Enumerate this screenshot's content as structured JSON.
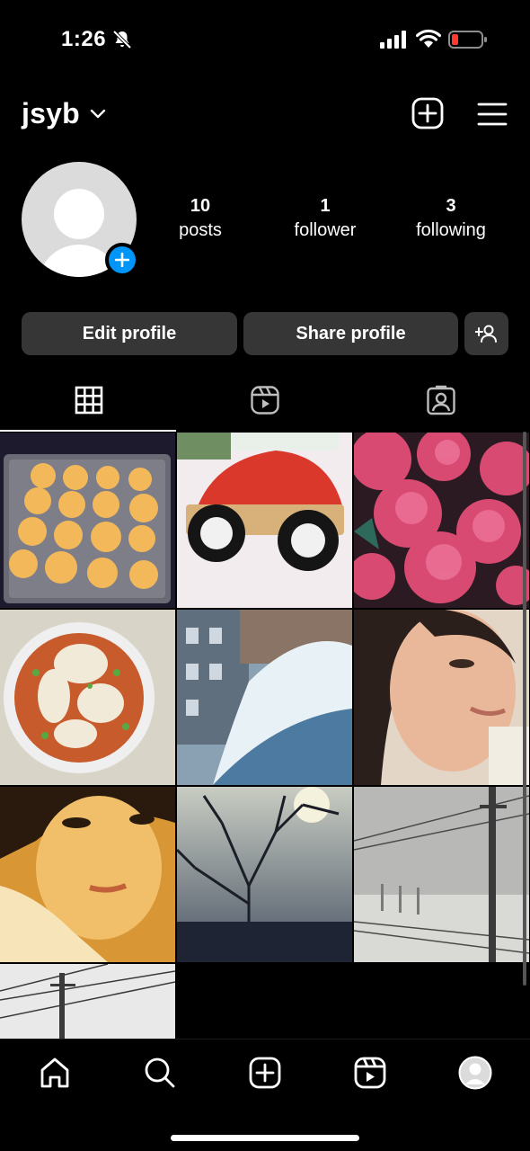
{
  "status_bar": {
    "time": "1:26",
    "icons": [
      "bell-slash-icon",
      "cellular-signal-icon",
      "wifi-icon",
      "battery-icon"
    ],
    "battery_color": "#ff3b30"
  },
  "header": {
    "username": "jsyb",
    "icons": [
      "chevron-down-icon",
      "plus-square-icon",
      "hamburger-menu-icon"
    ]
  },
  "profile": {
    "stats": {
      "posts": {
        "count": "10",
        "label": "posts"
      },
      "followers": {
        "count": "1",
        "label": "follower"
      },
      "following": {
        "count": "3",
        "label": "following"
      }
    },
    "buttons": {
      "edit": "Edit profile",
      "share": "Share profile"
    }
  },
  "tabs": [
    "grid-icon",
    "reels-icon",
    "tagged-icon"
  ],
  "grid": {
    "posts": [
      {
        "subject": "tray-of-baked-puffs"
      },
      {
        "subject": "red-wooden-toy-car"
      },
      {
        "subject": "pink-carnations"
      },
      {
        "subject": "dumpling-soup-bowl"
      },
      {
        "subject": "snowy-street-window-view"
      },
      {
        "subject": "selfie-woman"
      },
      {
        "subject": "close-up-face-yellow-tint"
      },
      {
        "subject": "bare-tree-silhouette"
      },
      {
        "subject": "foggy-railway-snow"
      },
      {
        "subject": "power-lines-sky"
      }
    ]
  },
  "bottom_nav": [
    "home-icon",
    "search-icon",
    "create-icon",
    "reels-icon",
    "profile-avatar-icon"
  ],
  "colors": {
    "background": "#000000",
    "button_bg": "#363636",
    "accent_blue": "#0095f6"
  }
}
